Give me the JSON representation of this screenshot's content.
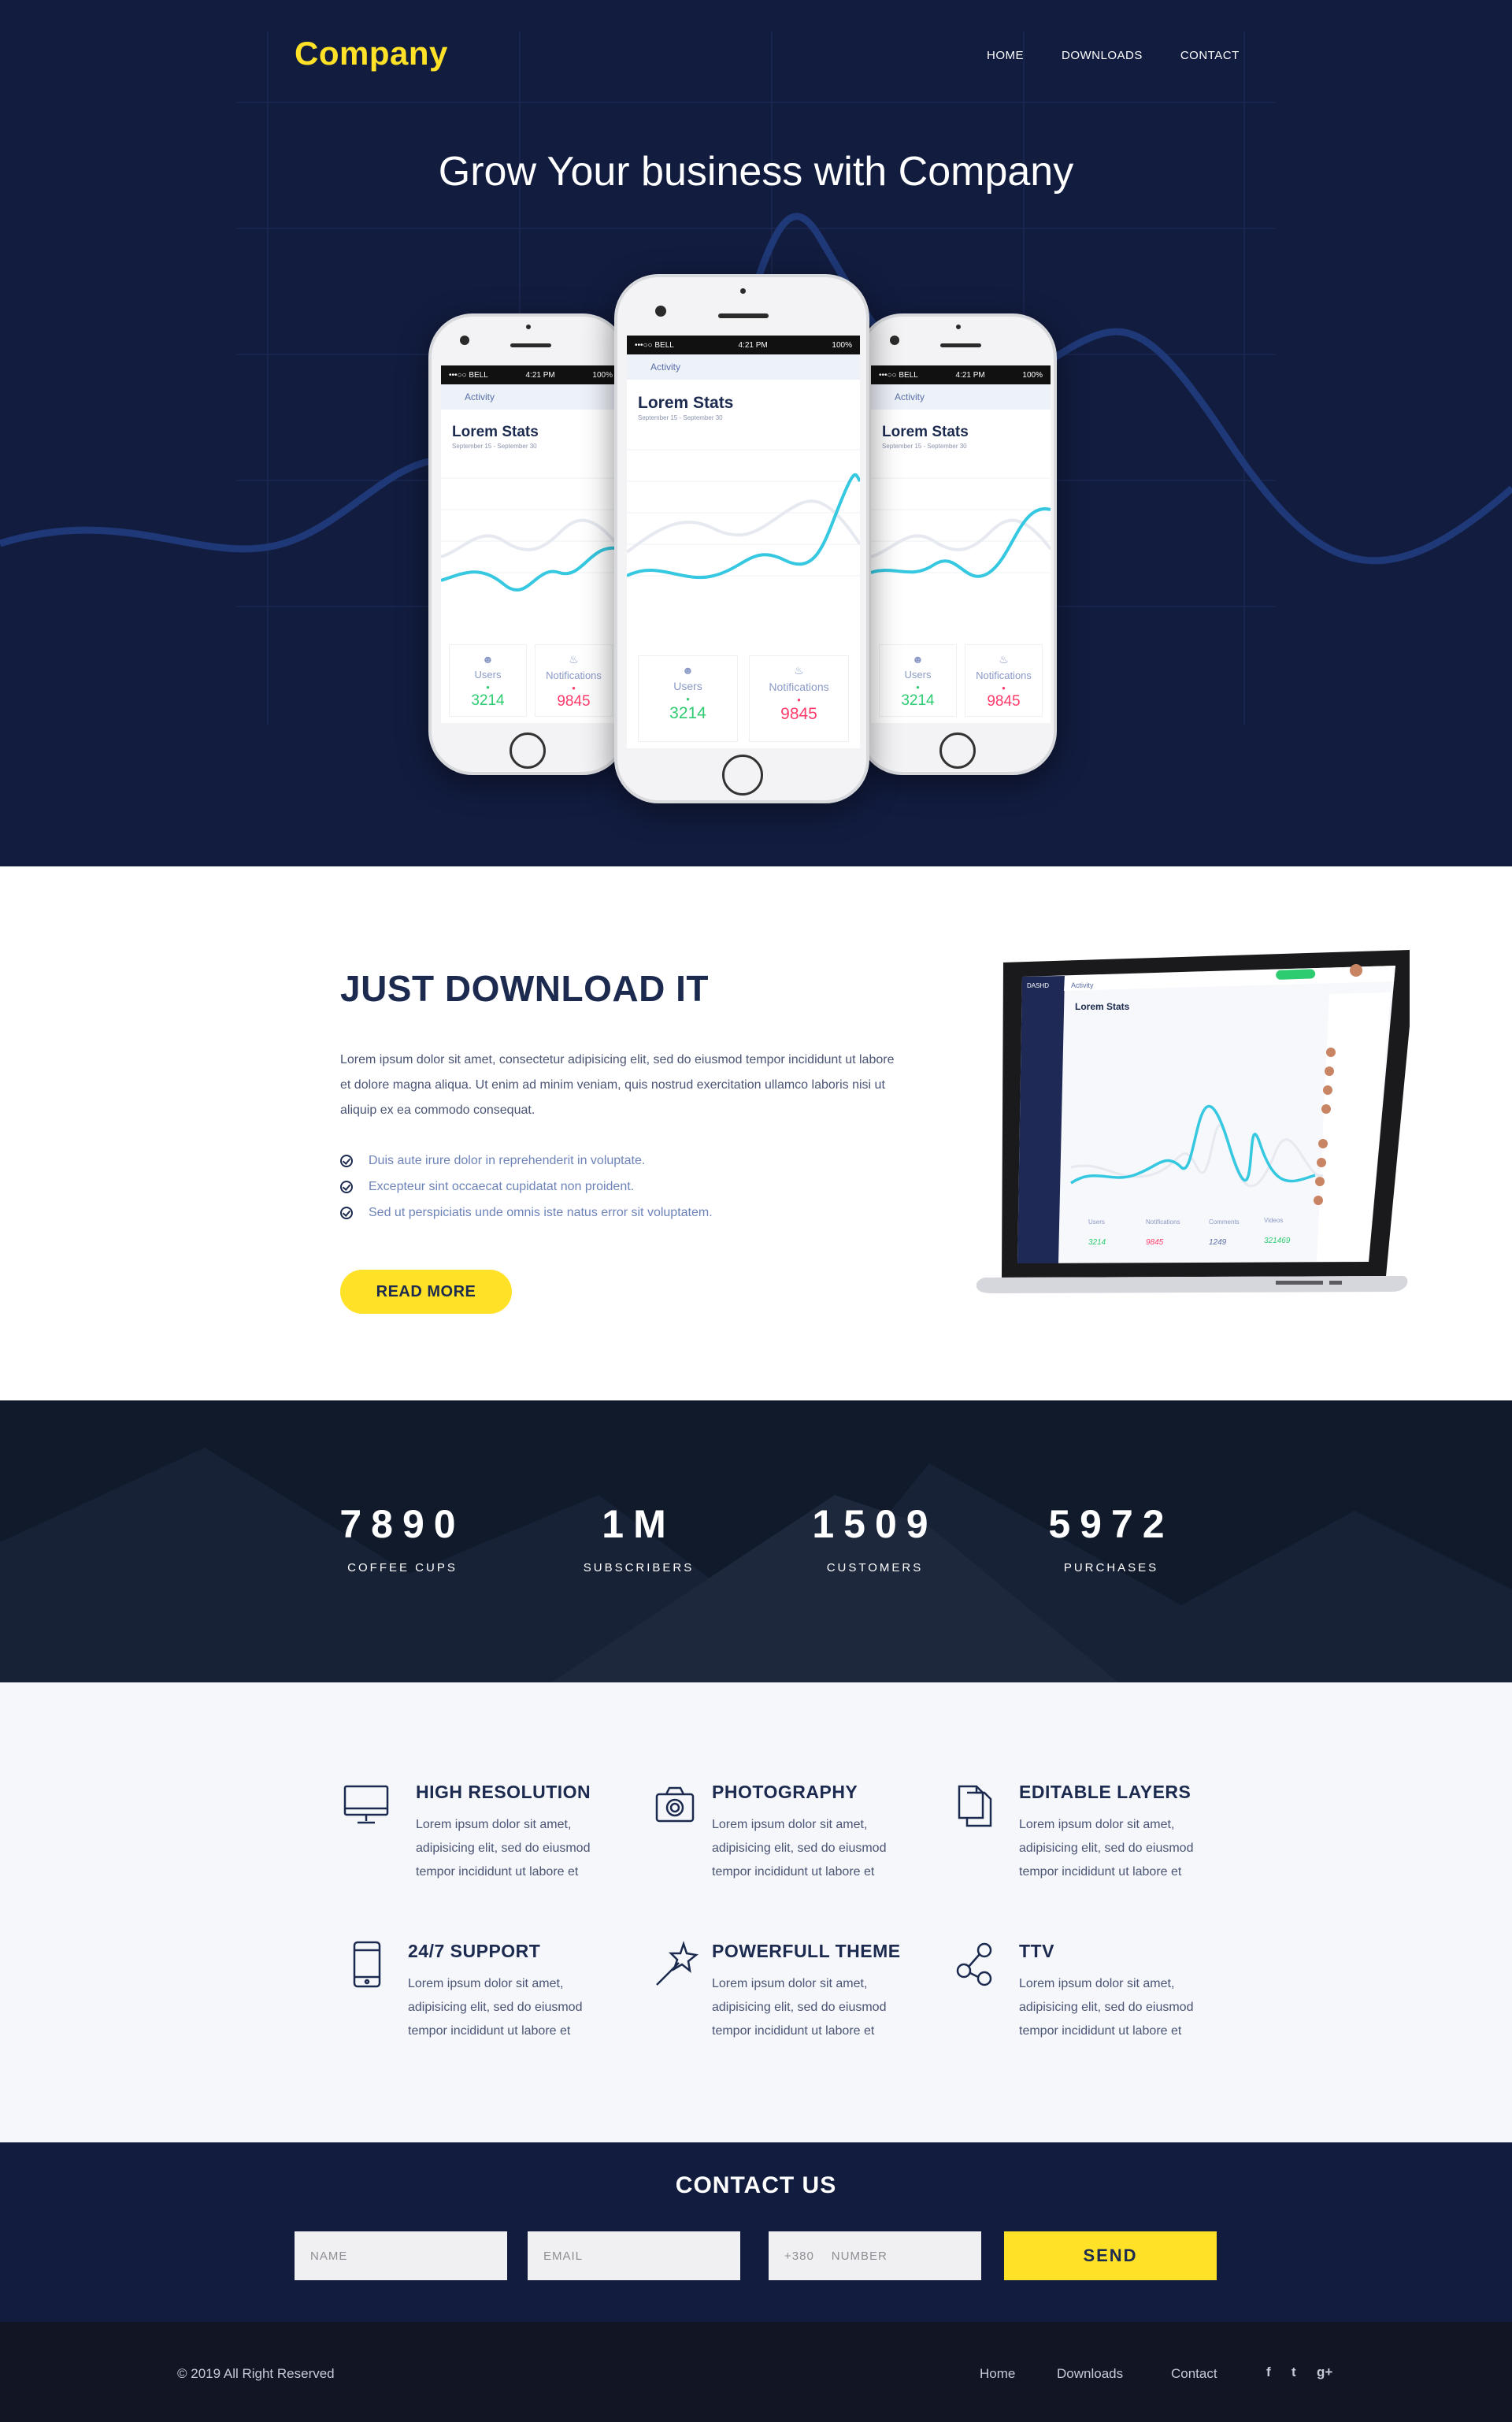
{
  "header": {
    "logo": "Company",
    "nav": [
      "HOME",
      "DOWNLOADS",
      "CONTACT"
    ]
  },
  "hero": {
    "title": "Grow Your business with Company",
    "phone_screen": {
      "status_left": "•••○○ BELL",
      "status_time": "4:21 PM",
      "status_right": "100%",
      "appbar": "Activity",
      "stats_title": "Lorem Stats",
      "stats_sub": "September 15 - September 30",
      "card1_label": "Users",
      "card1_value": "3214",
      "card2_label": "Notifications",
      "card2_value": "9845"
    }
  },
  "download": {
    "title": "JUST DOWNLOAD IT",
    "paragraph": "Lorem ipsum dolor sit amet, consectetur adipisicing elit, sed do eiusmod tempor incididunt ut labore et dolore magna aliqua. Ut enim ad minim veniam, quis nostrud exercitation ullamco laboris nisi ut aliquip ex ea commodo consequat.",
    "list": [
      "Duis aute irure dolor in reprehenderit in voluptate.",
      "Excepteur sint occaecat cupidatat non proident.",
      "Sed ut perspiciatis unde omnis iste natus error sit voluptatem."
    ],
    "button": "READ MORE",
    "laptop": {
      "brand": "DASHD",
      "appbar": "Activity",
      "stats_title": "Lorem Stats",
      "cards": [
        {
          "label": "Users",
          "value": "3214"
        },
        {
          "label": "Notifications",
          "value": "9845"
        },
        {
          "label": "Comments",
          "value": "1249"
        },
        {
          "label": "Videos",
          "value": "321469"
        }
      ]
    }
  },
  "stats": [
    {
      "number": "7890",
      "label": "COFFEE CUPS"
    },
    {
      "number": "1M",
      "label": "SUBSCRIBERS"
    },
    {
      "number": "1509",
      "label": "CUSTOMERS"
    },
    {
      "number": "5972",
      "label": "PURCHASES"
    }
  ],
  "features": [
    {
      "title": "HIGH RESOLUTION",
      "desc": "Lorem ipsum dolor sit amet, adipisicing elit, sed do eiusmod tempor incididunt ut labore et",
      "icon": "monitor-icon"
    },
    {
      "title": "PHOTOGRAPHY",
      "desc": "Lorem ipsum dolor sit amet, adipisicing elit, sed do eiusmod tempor incididunt ut labore et",
      "icon": "camera-icon"
    },
    {
      "title": "EDITABLE LAYERS",
      "desc": "Lorem ipsum dolor sit amet, adipisicing elit, sed do eiusmod tempor incididunt ut labore et",
      "icon": "documents-icon"
    },
    {
      "title": "24/7 SUPPORT",
      "desc": "Lorem ipsum dolor sit amet, adipisicing elit, sed do eiusmod tempor incididunt ut labore et",
      "icon": "phone-icon"
    },
    {
      "title": "POWERFULL THEME",
      "desc": "Lorem ipsum dolor sit amet, adipisicing elit, sed do eiusmod tempor incididunt ut labore et",
      "icon": "magic-wand-icon"
    },
    {
      "title": "TTV",
      "desc": "Lorem ipsum dolor sit amet, adipisicing elit, sed do eiusmod tempor incididunt ut labore et",
      "icon": "share-icon"
    }
  ],
  "contact": {
    "title": "CONTACT US",
    "name_placeholder": "NAME",
    "email_placeholder": "EMAIL",
    "phone_prefix": "+380",
    "number_placeholder": "NUMBER",
    "send": "SEND"
  },
  "footer": {
    "copyright": "© 2019  All Right Reserved",
    "links": [
      "Home",
      "Downloads",
      "Contact"
    ],
    "social": [
      "f",
      "t",
      "g+"
    ]
  },
  "colors": {
    "navy": "#121c3f",
    "accent_yellow": "#ffe227",
    "chart_cyan": "#35c8e0",
    "green_value": "#2ecc71",
    "pink_value": "#ff3b6b"
  }
}
